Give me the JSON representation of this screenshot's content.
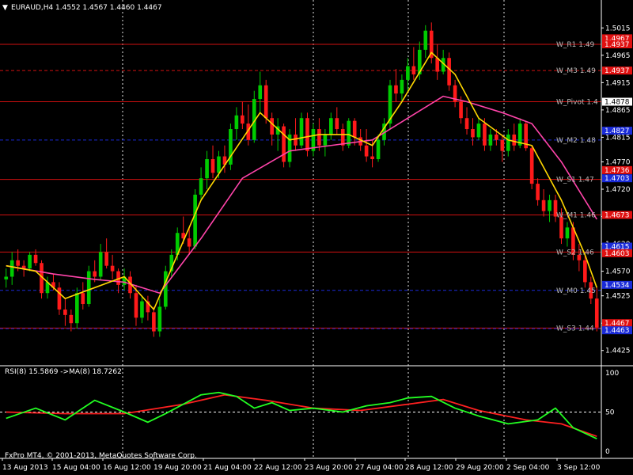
{
  "header": {
    "symbol_line": "EURAUD,H4  1.4552 1.4567 1.4460 1.4467",
    "menu_glyph": "▼"
  },
  "footer": {
    "copyright": "FxPro MT4, © 2001-2013, MetaQuotes Software Corp."
  },
  "rsi_panel": {
    "label": "RSI(8) 15.5869  ->MA(8) 18.7262"
  },
  "colors": {
    "background": "#000000",
    "bull_candle": "#00cc00",
    "bear_candle": "#ff1a1a",
    "fast_ma": "#ffd700",
    "slow_ma": "#ff44aa",
    "rsi": "#22ff22",
    "rsi_ma": "#ff2020",
    "grid": "#ffffff",
    "level_red": "#d01010",
    "level_blue": "#1a2bd8",
    "axis_text": "#ffffff"
  },
  "chart_data": {
    "type": "candlestick",
    "symbol": "EURAUD",
    "timeframe": "H4",
    "price_axis": {
      "range": [
        1.44,
        1.504
      ],
      "ticks": [
        "1.5015",
        "1.4965",
        "1.4915",
        "1.4865",
        "1.4815",
        "1.4770",
        "1.4720",
        "1.4670",
        "1.4620",
        "1.4570",
        "1.4525",
        "1.4475",
        "1.4425"
      ]
    },
    "time_axis": {
      "ticks": [
        "13 Aug 2013",
        "15 Aug 04:00",
        "16 Aug 12:00",
        "19 Aug 20:00",
        "21 Aug 04:00",
        "22 Aug 12:00",
        "23 Aug 20:00",
        "27 Aug 04:00",
        "28 Aug 12:00",
        "29 Aug 20:00",
        "2 Sep 04:00",
        "3 Sep 12:00"
      ]
    },
    "price_tags": [
      {
        "text": "1.4967",
        "price": 1.4996,
        "kind": "red"
      },
      {
        "text": "1.4937",
        "price": 1.4985,
        "kind": "red"
      },
      {
        "text": "1.4937",
        "price": 1.4937,
        "kind": "red"
      },
      {
        "text": "1.4878",
        "price": 1.488,
        "kind": "white"
      },
      {
        "text": "1.4827",
        "price": 1.4827,
        "kind": "blue"
      },
      {
        "text": "1.4736",
        "price": 1.4755,
        "kind": "red"
      },
      {
        "text": "1.4703",
        "price": 1.474,
        "kind": "blue"
      },
      {
        "text": "1.4673",
        "price": 1.4673,
        "kind": "red"
      },
      {
        "text": "1.4615",
        "price": 1.4615,
        "kind": "blue"
      },
      {
        "text": "1.4603",
        "price": 1.4603,
        "kind": "red"
      },
      {
        "text": "1.4534",
        "price": 1.4545,
        "kind": "blue"
      },
      {
        "text": "1.4467",
        "price": 1.4475,
        "kind": "red"
      },
      {
        "text": "1.4463",
        "price": 1.4462,
        "kind": "blue"
      }
    ],
    "levels": [
      {
        "label": "W_R1 1.49",
        "price": 1.4985,
        "color": "red",
        "style": "solid"
      },
      {
        "label": "W_M3 1.49",
        "price": 1.4937,
        "color": "red",
        "style": "dashed"
      },
      {
        "label": "W_Pivot 1.4",
        "price": 1.488,
        "color": "red",
        "style": "solid"
      },
      {
        "label": "W_M2 1.48",
        "price": 1.481,
        "color": "blue",
        "style": "dashed"
      },
      {
        "label": "W_S1 1.47",
        "price": 1.4738,
        "color": "red",
        "style": "solid"
      },
      {
        "label": "W_M1 1.46",
        "price": 1.4673,
        "color": "red",
        "style": "solid"
      },
      {
        "label": "W_S2 1.46",
        "price": 1.4605,
        "color": "red",
        "style": "solid"
      },
      {
        "label": "W_M0 1.45",
        "price": 1.4535,
        "color": "blue",
        "style": "dashed"
      },
      {
        "label": "W_S3 1.44",
        "price": 1.4466,
        "color": "red",
        "style": "solid"
      },
      {
        "label": "",
        "price": 1.4465,
        "color": "blue",
        "style": "dashed"
      }
    ],
    "candles": [
      [
        1.4555,
        1.4575,
        1.454,
        1.456
      ],
      [
        1.456,
        1.4605,
        1.4545,
        1.459
      ],
      [
        1.459,
        1.461,
        1.457,
        1.458
      ],
      [
        1.458,
        1.459,
        1.456,
        1.4575
      ],
      [
        1.4575,
        1.4605,
        1.457,
        1.46
      ],
      [
        1.46,
        1.461,
        1.458,
        1.4585
      ],
      [
        1.4585,
        1.459,
        1.452,
        1.453
      ],
      [
        1.453,
        1.456,
        1.452,
        1.455
      ],
      [
        1.455,
        1.4565,
        1.4535,
        1.454
      ],
      [
        1.454,
        1.455,
        1.449,
        1.45
      ],
      [
        1.45,
        1.452,
        1.447,
        1.449
      ],
      [
        1.449,
        1.45,
        1.446,
        1.4475
      ],
      [
        1.4475,
        1.454,
        1.4465,
        1.453
      ],
      [
        1.453,
        1.455,
        1.45,
        1.451
      ],
      [
        1.451,
        1.458,
        1.4505,
        1.457
      ],
      [
        1.457,
        1.459,
        1.455,
        1.456
      ],
      [
        1.456,
        1.462,
        1.4555,
        1.4605
      ],
      [
        1.4605,
        1.463,
        1.4575,
        1.458
      ],
      [
        1.458,
        1.46,
        1.4555,
        1.457
      ],
      [
        1.457,
        1.4575,
        1.453,
        1.4545
      ],
      [
        1.4545,
        1.4575,
        1.4535,
        1.456
      ],
      [
        1.456,
        1.457,
        1.452,
        1.453
      ],
      [
        1.453,
        1.4545,
        1.447,
        1.4485
      ],
      [
        1.4485,
        1.4525,
        1.4475,
        1.4515
      ],
      [
        1.4515,
        1.4525,
        1.448,
        1.4495
      ],
      [
        1.4495,
        1.4505,
        1.445,
        1.446
      ],
      [
        1.446,
        1.452,
        1.445,
        1.4505
      ],
      [
        1.4505,
        1.458,
        1.45,
        1.457
      ],
      [
        1.457,
        1.461,
        1.456,
        1.46
      ],
      [
        1.46,
        1.465,
        1.459,
        1.464
      ],
      [
        1.464,
        1.467,
        1.462,
        1.463
      ],
      [
        1.463,
        1.465,
        1.46,
        1.4615
      ],
      [
        1.4615,
        1.472,
        1.461,
        1.471
      ],
      [
        1.471,
        1.476,
        1.47,
        1.474
      ],
      [
        1.474,
        1.479,
        1.472,
        1.4775
      ],
      [
        1.4775,
        1.48,
        1.474,
        1.475
      ],
      [
        1.475,
        1.479,
        1.474,
        1.478
      ],
      [
        1.478,
        1.48,
        1.475,
        1.4765
      ],
      [
        1.4765,
        1.484,
        1.4755,
        1.483
      ],
      [
        1.483,
        1.487,
        1.481,
        1.4855
      ],
      [
        1.4855,
        1.488,
        1.483,
        1.484
      ],
      [
        1.484,
        1.4875,
        1.48,
        1.481
      ],
      [
        1.481,
        1.49,
        1.4805,
        1.4885
      ],
      [
        1.4885,
        1.4935,
        1.486,
        1.491
      ],
      [
        1.491,
        1.492,
        1.484,
        1.485
      ],
      [
        1.485,
        1.486,
        1.48,
        1.482
      ],
      [
        1.482,
        1.485,
        1.479,
        1.4835
      ],
      [
        1.4835,
        1.484,
        1.476,
        1.477
      ],
      [
        1.477,
        1.483,
        1.476,
        1.482
      ],
      [
        1.482,
        1.485,
        1.479,
        1.48
      ],
      [
        1.48,
        1.486,
        1.4795,
        1.485
      ],
      [
        1.485,
        1.486,
        1.478,
        1.479
      ],
      [
        1.479,
        1.484,
        1.478,
        1.483
      ],
      [
        1.483,
        1.485,
        1.479,
        1.48
      ],
      [
        1.48,
        1.483,
        1.478,
        1.482
      ],
      [
        1.482,
        1.486,
        1.481,
        1.485
      ],
      [
        1.485,
        1.487,
        1.482,
        1.483
      ],
      [
        1.483,
        1.484,
        1.479,
        1.48
      ],
      [
        1.48,
        1.485,
        1.4795,
        1.4845
      ],
      [
        1.4845,
        1.485,
        1.48,
        1.4815
      ],
      [
        1.4815,
        1.483,
        1.479,
        1.48
      ],
      [
        1.48,
        1.483,
        1.477,
        1.478
      ],
      [
        1.478,
        1.481,
        1.476,
        1.4775
      ],
      [
        1.4775,
        1.482,
        1.477,
        1.481
      ],
      [
        1.481,
        1.485,
        1.48,
        1.484
      ],
      [
        1.484,
        1.492,
        1.483,
        1.491
      ],
      [
        1.491,
        1.494,
        1.488,
        1.4895
      ],
      [
        1.4895,
        1.493,
        1.488,
        1.492
      ],
      [
        1.492,
        1.496,
        1.49,
        1.4945
      ],
      [
        1.4945,
        1.498,
        1.492,
        1.493
      ],
      [
        1.493,
        1.499,
        1.492,
        1.4975
      ],
      [
        1.4975,
        1.502,
        1.496,
        1.501
      ],
      [
        1.501,
        1.5025,
        1.495,
        1.496
      ],
      [
        1.496,
        1.4985,
        1.492,
        1.4935
      ],
      [
        1.4935,
        1.4975,
        1.493,
        1.496
      ],
      [
        1.496,
        1.497,
        1.49,
        1.491
      ],
      [
        1.491,
        1.492,
        1.487,
        1.488
      ],
      [
        1.488,
        1.489,
        1.484,
        1.485
      ],
      [
        1.485,
        1.487,
        1.482,
        1.483
      ],
      [
        1.483,
        1.485,
        1.48,
        1.4815
      ],
      [
        1.4815,
        1.485,
        1.481,
        1.484
      ],
      [
        1.484,
        1.485,
        1.479,
        1.48
      ],
      [
        1.48,
        1.483,
        1.479,
        1.482
      ],
      [
        1.482,
        1.483,
        1.48,
        1.481
      ],
      [
        1.481,
        1.482,
        1.477,
        1.479
      ],
      [
        1.479,
        1.483,
        1.478,
        1.482
      ],
      [
        1.482,
        1.484,
        1.479,
        1.48
      ],
      [
        1.48,
        1.485,
        1.4795,
        1.484
      ],
      [
        1.484,
        1.4845,
        1.479,
        1.4795
      ],
      [
        1.4795,
        1.48,
        1.472,
        1.473
      ],
      [
        1.473,
        1.474,
        1.469,
        1.47
      ],
      [
        1.47,
        1.472,
        1.467,
        1.468
      ],
      [
        1.468,
        1.471,
        1.466,
        1.47
      ],
      [
        1.47,
        1.471,
        1.466,
        1.467
      ],
      [
        1.467,
        1.4685,
        1.462,
        1.463
      ],
      [
        1.463,
        1.466,
        1.4615,
        1.465
      ],
      [
        1.465,
        1.466,
        1.459,
        1.46
      ],
      [
        1.46,
        1.462,
        1.457,
        1.459
      ],
      [
        1.459,
        1.46,
        1.454,
        1.455
      ],
      [
        1.455,
        1.456,
        1.451,
        1.452
      ],
      [
        1.452,
        1.454,
        1.446,
        1.4467
      ]
    ],
    "fast_ma": [
      [
        0,
        1.458
      ],
      [
        5,
        1.457
      ],
      [
        10,
        1.452
      ],
      [
        15,
        1.454
      ],
      [
        20,
        1.456
      ],
      [
        25,
        1.45
      ],
      [
        29,
        1.46
      ],
      [
        33,
        1.47
      ],
      [
        38,
        1.478
      ],
      [
        43,
        1.486
      ],
      [
        48,
        1.481
      ],
      [
        53,
        1.482
      ],
      [
        58,
        1.482
      ],
      [
        62,
        1.48
      ],
      [
        67,
        1.488
      ],
      [
        72,
        1.497
      ],
      [
        76,
        1.493
      ],
      [
        80,
        1.485
      ],
      [
        85,
        1.481
      ],
      [
        89,
        1.48
      ],
      [
        94,
        1.47
      ],
      [
        98,
        1.46
      ],
      [
        100,
        1.454
      ]
    ],
    "slow_ma": [
      [
        0,
        1.458
      ],
      [
        8,
        1.4565
      ],
      [
        15,
        1.4555
      ],
      [
        20,
        1.455
      ],
      [
        26,
        1.453
      ],
      [
        33,
        1.463
      ],
      [
        40,
        1.474
      ],
      [
        48,
        1.479
      ],
      [
        55,
        1.48
      ],
      [
        62,
        1.481
      ],
      [
        68,
        1.485
      ],
      [
        74,
        1.489
      ],
      [
        78,
        1.488
      ],
      [
        84,
        1.486
      ],
      [
        89,
        1.484
      ],
      [
        94,
        1.477
      ],
      [
        98,
        1.47
      ],
      [
        100,
        1.4665
      ]
    ],
    "rsi_axis": {
      "range": [
        0,
        100
      ],
      "ticks": [
        "100",
        "50",
        "0"
      ]
    },
    "rsi": [
      [
        0,
        42
      ],
      [
        5,
        55
      ],
      [
        10,
        40
      ],
      [
        15,
        65
      ],
      [
        20,
        50
      ],
      [
        24,
        37
      ],
      [
        27,
        48
      ],
      [
        30,
        60
      ],
      [
        33,
        72
      ],
      [
        36,
        75
      ],
      [
        39,
        70
      ],
      [
        42,
        55
      ],
      [
        45,
        62
      ],
      [
        48,
        52
      ],
      [
        52,
        55
      ],
      [
        57,
        50
      ],
      [
        61,
        58
      ],
      [
        65,
        62
      ],
      [
        68,
        68
      ],
      [
        72,
        70
      ],
      [
        76,
        55
      ],
      [
        80,
        45
      ],
      [
        85,
        35
      ],
      [
        90,
        40
      ],
      [
        93,
        55
      ],
      [
        96,
        30
      ],
      [
        100,
        16
      ]
    ],
    "rsi_ma": [
      [
        0,
        50
      ],
      [
        10,
        48
      ],
      [
        20,
        48
      ],
      [
        30,
        60
      ],
      [
        37,
        72
      ],
      [
        44,
        65
      ],
      [
        52,
        55
      ],
      [
        60,
        52
      ],
      [
        68,
        60
      ],
      [
        74,
        66
      ],
      [
        80,
        52
      ],
      [
        88,
        40
      ],
      [
        94,
        35
      ],
      [
        100,
        19
      ]
    ]
  }
}
